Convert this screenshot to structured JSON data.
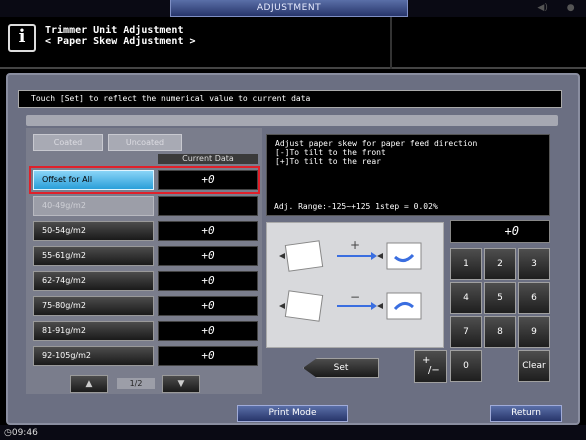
{
  "window": {
    "title": "ADJUSTMENT",
    "right_icons": [
      "speaker-icon",
      "dot-icon"
    ],
    "right_glyphs": [
      "◀)",
      "●"
    ]
  },
  "header": {
    "info_glyph": "i",
    "line1": "Trimmer Unit Adjustment",
    "line2": "< Paper Skew Adjustment >"
  },
  "message": "Touch [Set] to reflect the numerical value to current data",
  "paper_type_tabs": [
    {
      "label": "Coated",
      "enabled": false
    },
    {
      "label": "Uncoated",
      "enabled": false
    }
  ],
  "current_data_header": "Current Data",
  "rows": [
    {
      "label": "Offset for All",
      "value": "+0",
      "selected": true,
      "enabled": true
    },
    {
      "label": "40-49g/m2",
      "value": "",
      "selected": false,
      "enabled": false
    },
    {
      "label": "50-54g/m2",
      "value": "+0",
      "selected": false,
      "enabled": true
    },
    {
      "label": "55-61g/m2",
      "value": "+0",
      "selected": false,
      "enabled": true
    },
    {
      "label": "62-74g/m2",
      "value": "+0",
      "selected": false,
      "enabled": true
    },
    {
      "label": "75-80g/m2",
      "value": "+0",
      "selected": false,
      "enabled": true
    },
    {
      "label": "81-91g/m2",
      "value": "+0",
      "selected": false,
      "enabled": true
    },
    {
      "label": "92-105g/m2",
      "value": "+0",
      "selected": false,
      "enabled": true
    }
  ],
  "pager": {
    "up": "▲",
    "down": "▼",
    "page": "1/2"
  },
  "description": {
    "line1": "Adjust paper skew for paper feed direction",
    "line2": "[-]To tilt to the front",
    "line3": "[+]To tilt to the rear",
    "range": "Adj. Range:-125~+125 1step = 0.02%"
  },
  "diagram": {
    "plus_symbol": "+",
    "minus_symbol": "−"
  },
  "keypad": {
    "display": "+0",
    "keys": [
      "1",
      "2",
      "3",
      "4",
      "5",
      "6",
      "7",
      "8",
      "9"
    ],
    "zero": "0",
    "plus_minus_top": "+",
    "plus_minus_bottom": "/−",
    "clear": "Clear"
  },
  "set_label": "Set",
  "footer": {
    "print_mode": "Print Mode",
    "return": "Return",
    "time": "09:46"
  },
  "colors": {
    "accent_selected": "#2a9fd9",
    "highlight_border": "#e0202a",
    "arrow_blue": "#3a6ee0"
  }
}
